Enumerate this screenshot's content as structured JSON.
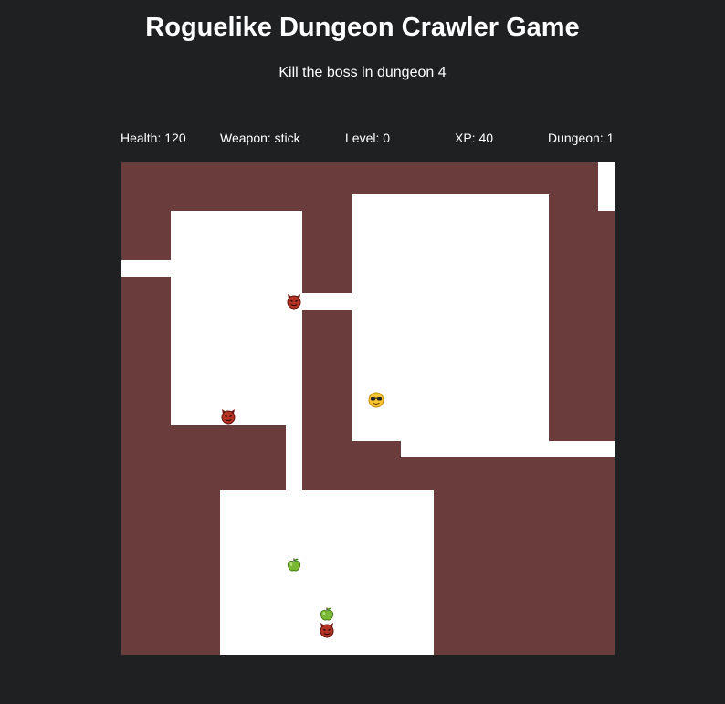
{
  "header": {
    "title": "Roguelike Dungeon Crawler Game",
    "subtitle": "Kill the boss in dungeon 4"
  },
  "stats": {
    "health": "Health: 120",
    "weapon": "Weapon: stick",
    "level": "Level: 0",
    "xp": "XP: 40",
    "dungeon": "Dungeon: 1"
  },
  "colors": {
    "background": "#1f2022",
    "wall": "#6a3d3c",
    "floor": "#ffffff"
  },
  "entities": {
    "player": "player-sunglasses-icon",
    "enemy": "enemy-devil-icon",
    "health_item": "green-apple-icon"
  }
}
